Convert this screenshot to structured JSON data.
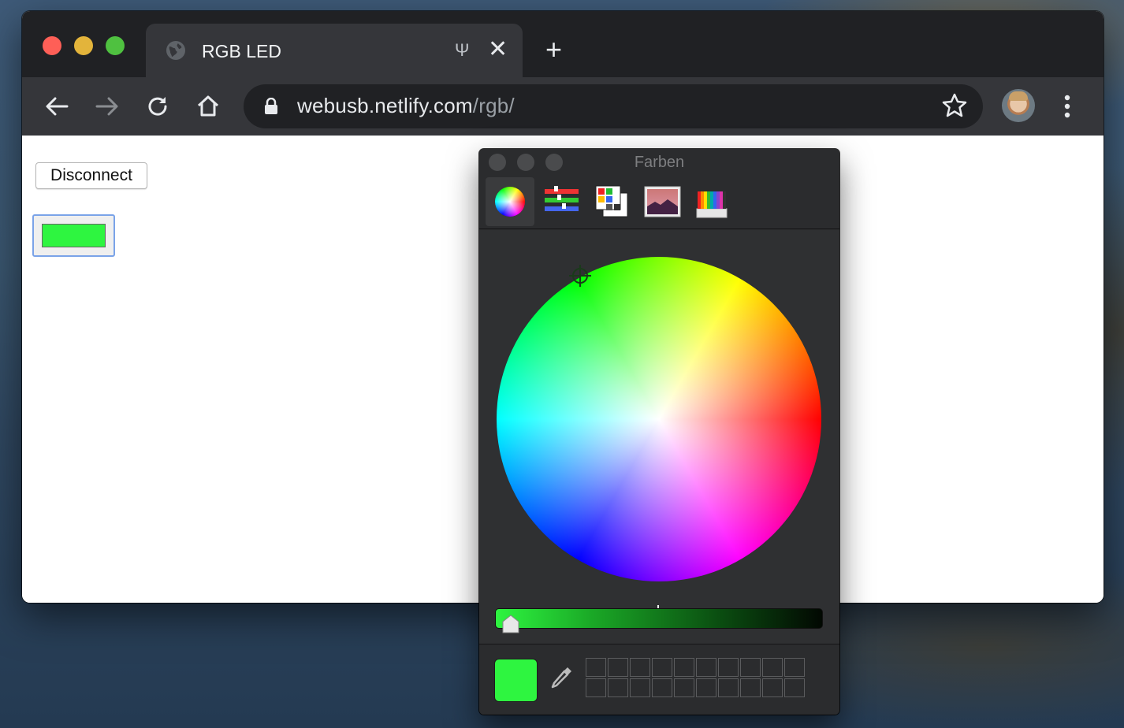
{
  "browser": {
    "tab": {
      "title": "RGB LED",
      "usb_indicator": "Ψ",
      "close_glyph": "✕",
      "favicon": "globe-icon"
    },
    "new_tab_glyph": "+",
    "toolbar": {
      "back_icon": "arrow-left-icon",
      "forward_icon": "arrow-right-icon",
      "reload_icon": "reload-icon",
      "home_icon": "home-icon"
    },
    "omnibox": {
      "host": "webusb.netlify.com",
      "path": "/rgb/",
      "lock_icon": "lock-icon",
      "star_icon": "star-icon"
    }
  },
  "page": {
    "disconnect_label": "Disconnect",
    "color_value": "#2ef540"
  },
  "color_panel": {
    "title": "Farben",
    "tabs": [
      {
        "name": "color-wheel"
      },
      {
        "name": "color-sliders"
      },
      {
        "name": "color-palettes"
      },
      {
        "name": "image-palettes"
      },
      {
        "name": "pencils"
      }
    ],
    "selected_tab": "color-wheel",
    "brightness_fraction": 0.05,
    "current_color": "#2ef540",
    "swatch_wells": 20
  },
  "colors": {
    "accent_green": "#2ef540",
    "focus_ring": "#7aa3e8",
    "tabstrip": "#202124",
    "toolbar": "#35363a"
  }
}
